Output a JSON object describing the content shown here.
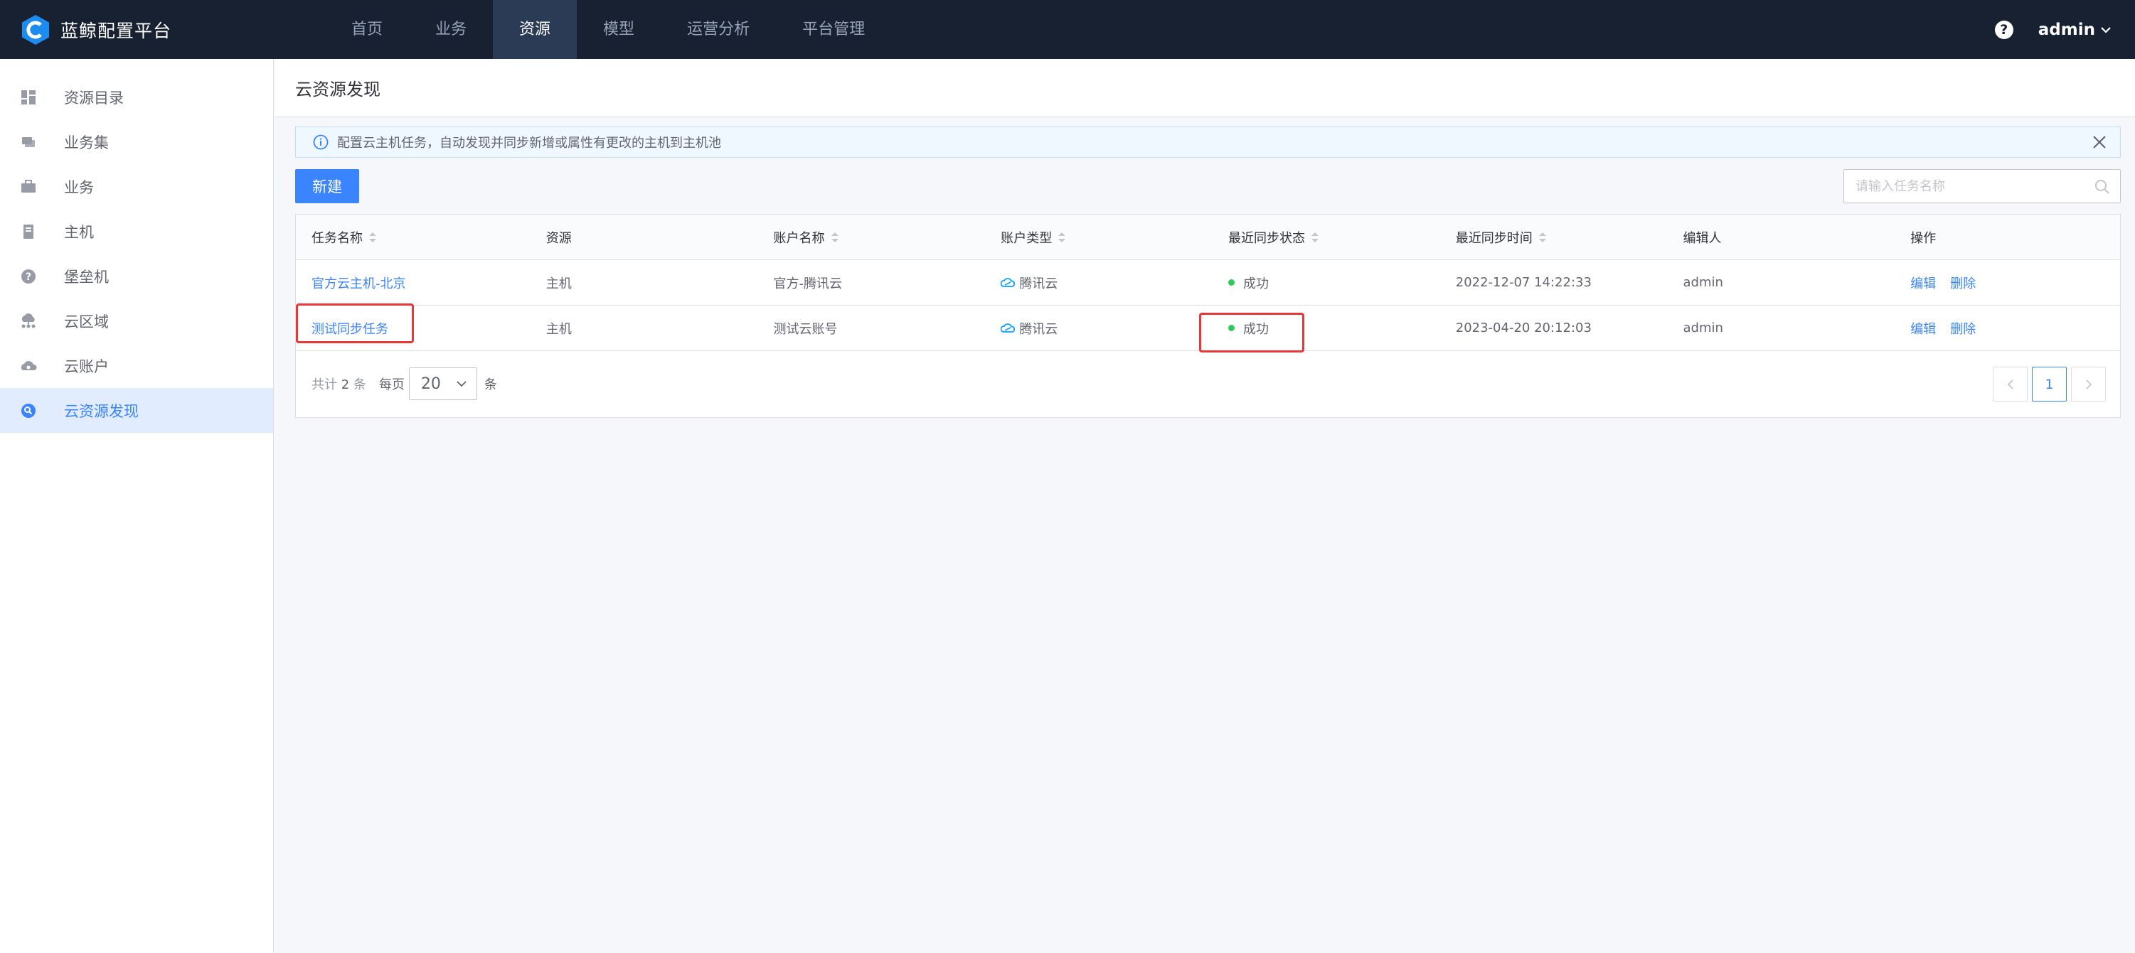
{
  "app": {
    "title": "蓝鲸配置平台",
    "nav": [
      "首页",
      "业务",
      "资源",
      "模型",
      "运营分析",
      "平台管理"
    ],
    "user": "admin"
  },
  "sidebar": {
    "items": [
      {
        "label": "资源目录",
        "icon": "grid-icon"
      },
      {
        "label": "业务集",
        "icon": "business-set-icon"
      },
      {
        "label": "业务",
        "icon": "briefcase-icon"
      },
      {
        "label": "主机",
        "icon": "host-icon"
      },
      {
        "label": "堡垒机",
        "icon": "question-icon"
      },
      {
        "label": "云区域",
        "icon": "cloud-area-icon"
      },
      {
        "label": "云账户",
        "icon": "cloud-account-icon"
      },
      {
        "label": "云资源发现",
        "icon": "cloud-discover-icon"
      }
    ],
    "active": "云资源发现"
  },
  "page": {
    "title": "云资源发现",
    "alert": "配置云主机任务，自动发现并同步新增或属性有更改的主机到主机池",
    "new_button": "新建",
    "search_placeholder": "请输入任务名称"
  },
  "table": {
    "headers": [
      "任务名称",
      "资源",
      "账户名称",
      "账户类型",
      "最近同步状态",
      "最近同步时间",
      "编辑人",
      "操作"
    ],
    "rows": [
      {
        "name": "官方云主机-北京",
        "resource": "主机",
        "account": "官方-腾讯云",
        "account_type": "腾讯云",
        "status": "成功",
        "time": "2022-12-07 14:22:33",
        "editor": "admin",
        "edit": "编辑",
        "delete": "删除"
      },
      {
        "name": "测试同步任务",
        "resource": "主机",
        "account": "测试云账号",
        "account_type": "腾讯云",
        "status": "成功",
        "time": "2023-04-20 20:12:03",
        "editor": "admin",
        "edit": "编辑",
        "delete": "删除"
      }
    ]
  },
  "pagination": {
    "total_prefix": "共计",
    "total": "2",
    "total_suffix": "条",
    "per_page_label": "每页",
    "per_page": "20",
    "per_page_unit": "条",
    "current_page": "1"
  },
  "colors": {
    "topbar": "#182132",
    "accent": "#3a84ff",
    "success": "#2dcb56",
    "highlight": "#ea3636"
  }
}
